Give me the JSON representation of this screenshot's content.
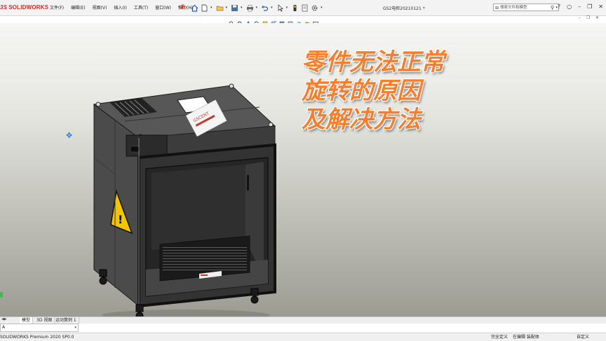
{
  "app": {
    "logo_ds": "3S",
    "logo_name": "SOLIDWORKS",
    "document_title": "GS2电柜20210121 *"
  },
  "menu": [
    "文件(F)",
    "编辑(E)",
    "视图(V)",
    "插入(I)",
    "工具(T)",
    "窗口(W)",
    "帮助(H)"
  ],
  "search": {
    "placeholder": "搜索文件和模型"
  },
  "overlay": {
    "line1": "零件无法正常",
    "line2": "旋转的原因",
    "line3": "及解决方法"
  },
  "tabs": [
    "模型",
    "3D 视图",
    "运动算例 1"
  ],
  "sidefield": {
    "value": "A"
  },
  "status": {
    "product": "SOLIDWORKS Premium 2020 SP0.0",
    "underdefined": "完全定义",
    "editing": "在编辑 装配体",
    "custom": "自定义"
  },
  "colors": {
    "brand": "#d7261e",
    "overlay_text": "#f47f2e",
    "cabinet_body": "#3f3f3f",
    "tab_accent": "#2b6cc4"
  },
  "icons": {
    "quick_access": [
      "home-icon",
      "new-file-icon",
      "open-icon",
      "save-icon",
      "print-icon",
      "undo-icon",
      "select-icon",
      "rebuild-icon",
      "options-icon"
    ],
    "heads_up": [
      "zoom-fit-icon",
      "zoom-area-icon",
      "previous-view-icon",
      "section-view-icon",
      "dynamic-annotation-icon",
      "view-orientation-icon",
      "display-style-icon",
      "hide-show-icon",
      "edit-appearance-icon",
      "apply-scene-icon",
      "view-settings-icon"
    ],
    "window": [
      "search-icon",
      "help-icon",
      "user-icon",
      "minimize-icon",
      "restore-icon",
      "close-icon"
    ]
  }
}
